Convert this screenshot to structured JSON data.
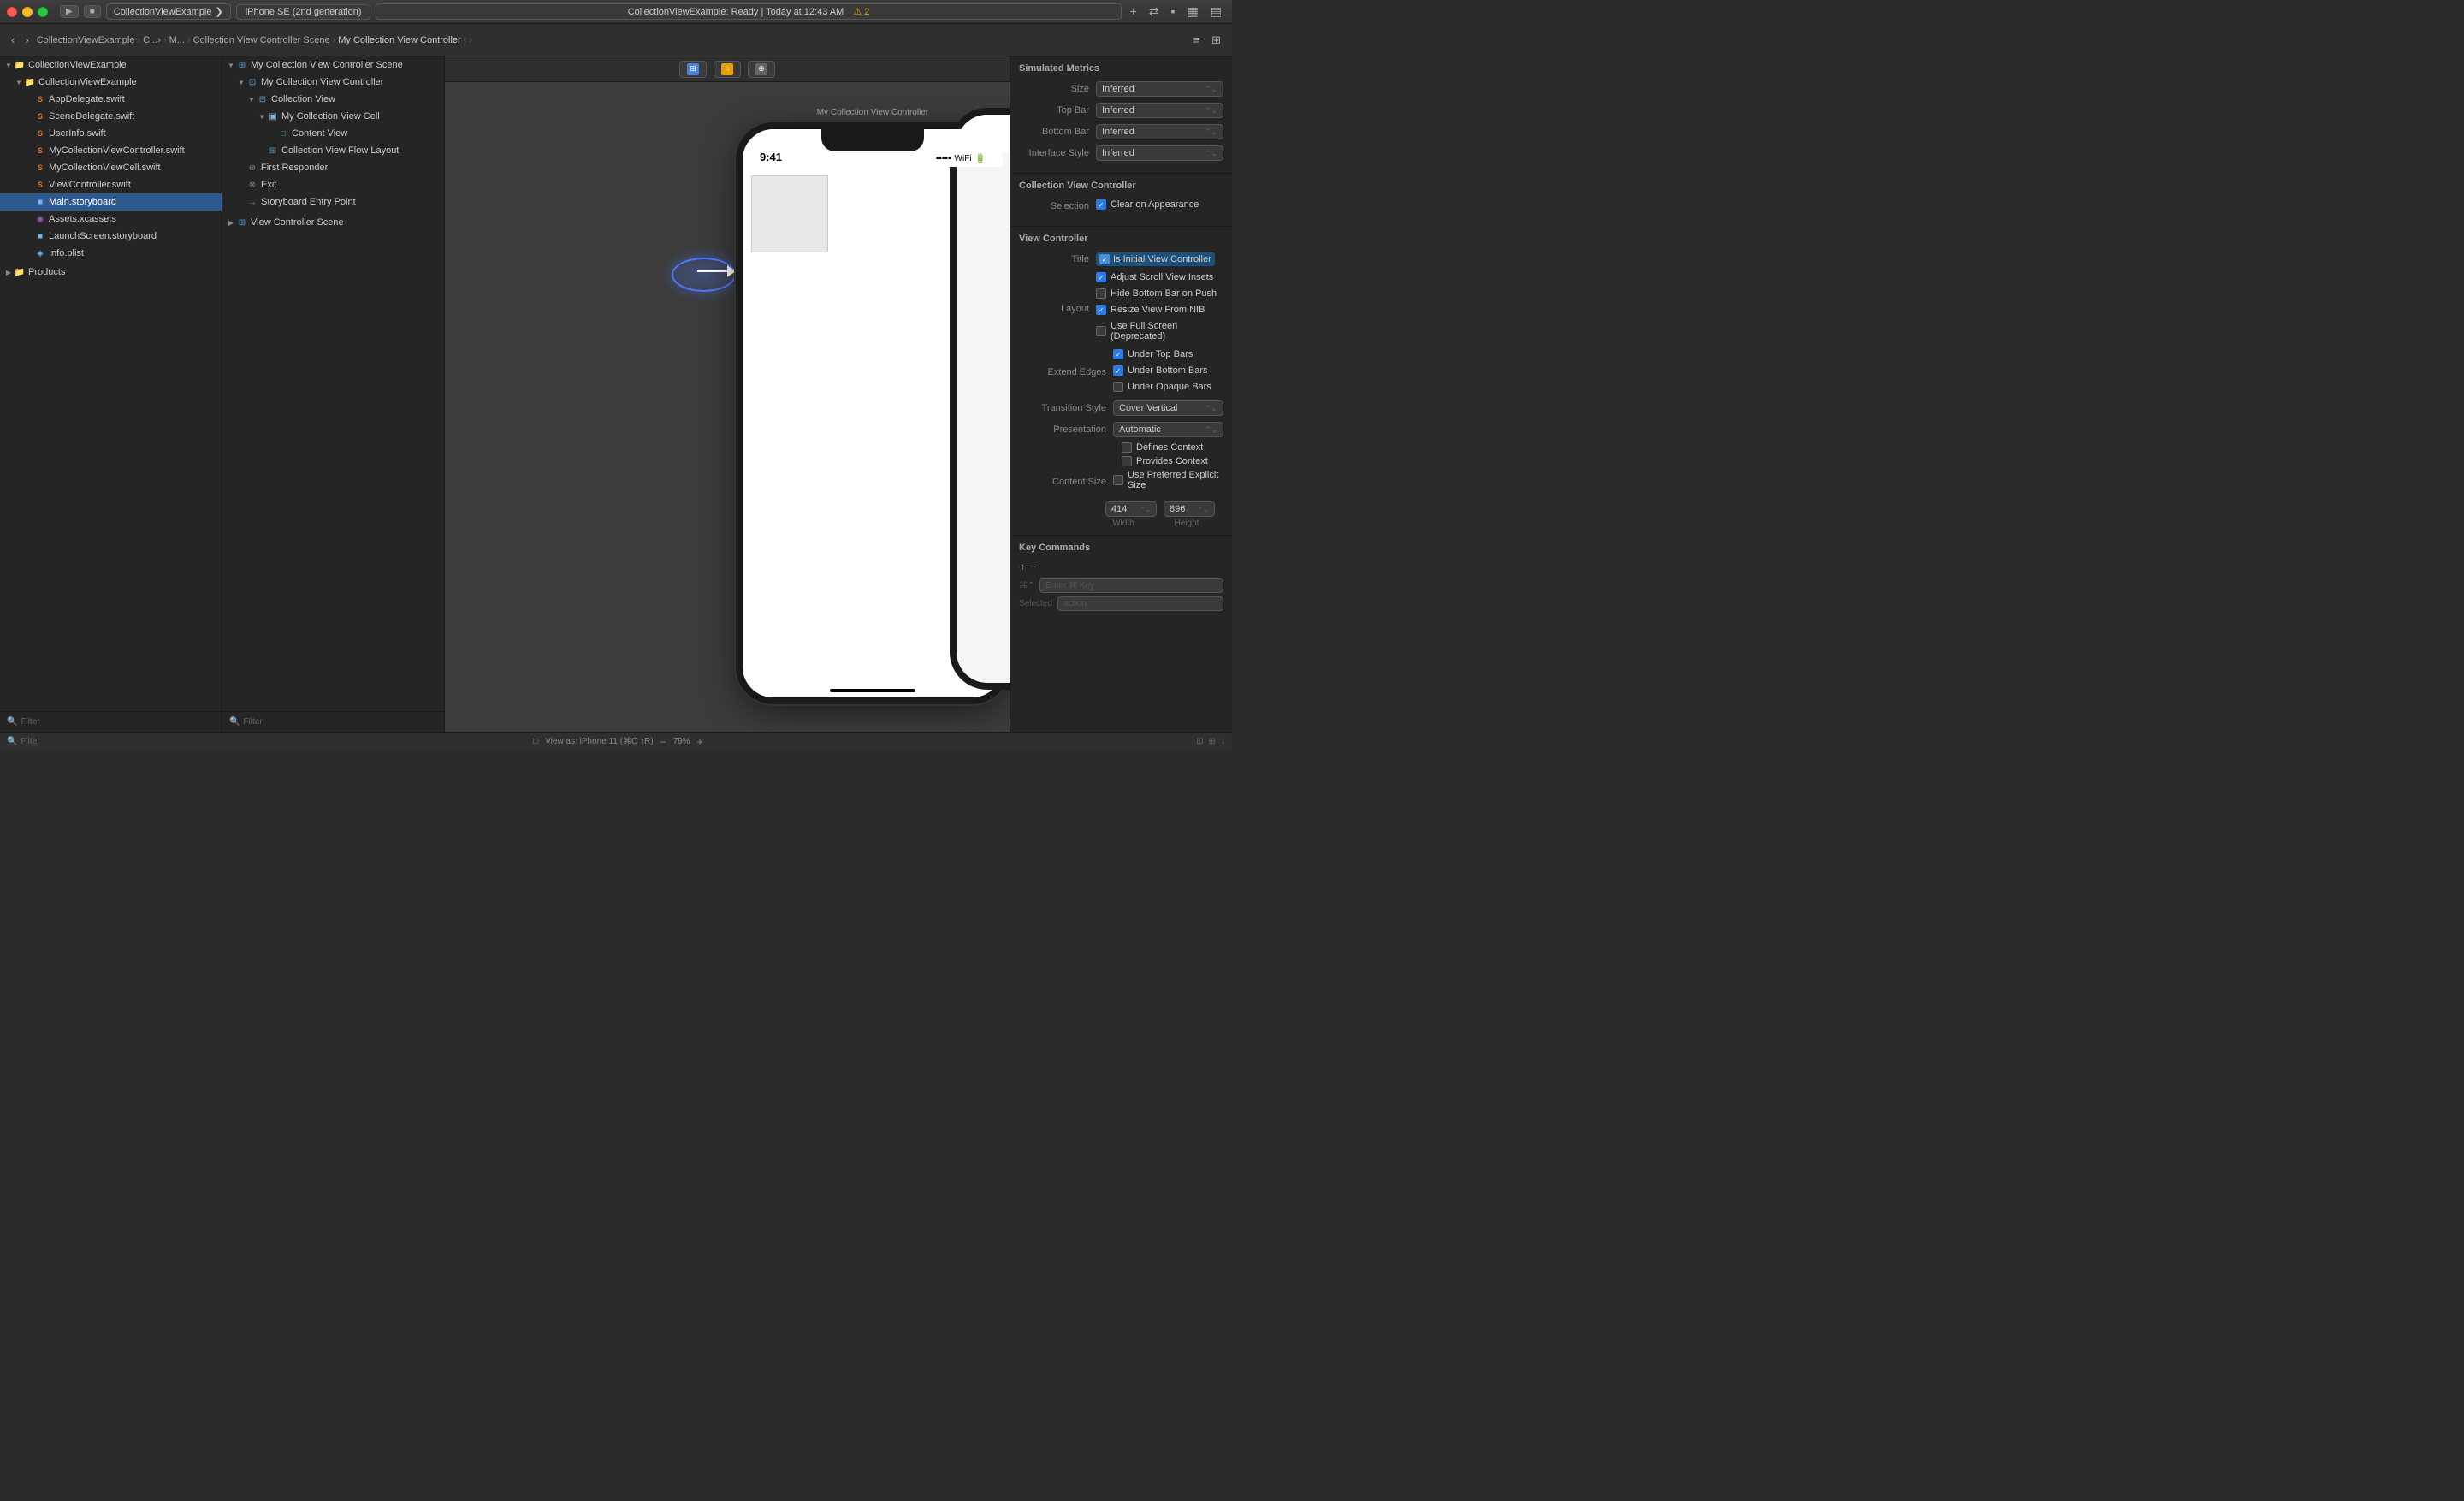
{
  "titlebar": {
    "traffic_lights": [
      "close",
      "minimize",
      "maximize"
    ],
    "scheme_label": "CollectionViewExample",
    "scheme_arrow": "▸",
    "device_label": "iPhone SE (2nd generation)",
    "status_label": "CollectionViewExample: Ready",
    "status_time": "Today at 12:43 AM",
    "warning_icon": "⚠",
    "warning_count": "2",
    "add_btn": "+",
    "arrows_btn": "⇄",
    "layout_btns": [
      "▪",
      "▦",
      "▤"
    ]
  },
  "toolbar": {
    "nav_back": "‹",
    "nav_forward": "›",
    "breadcrumbs": [
      "CollectionViewExample",
      "C...>",
      "M...",
      "Collection View Controller Scene",
      "My Collection View Controller"
    ],
    "nav_arrows": [
      "‹",
      "›"
    ],
    "right_icons": [
      "≡",
      "⊞"
    ]
  },
  "navigator": {
    "title": "CollectionViewExample",
    "root_folder": "CollectionViewExample",
    "items": [
      {
        "label": "CollectionViewExample",
        "type": "group_folder",
        "level": 0,
        "expanded": true
      },
      {
        "label": "AppDelegate.swift",
        "type": "swift",
        "level": 1
      },
      {
        "label": "SceneDelegate.swift",
        "type": "swift",
        "level": 1
      },
      {
        "label": "UserInfo.swift",
        "type": "swift",
        "level": 1
      },
      {
        "label": "MyCollectionViewController.swift",
        "type": "swift",
        "level": 1
      },
      {
        "label": "MyCollectionViewCell.swift",
        "type": "swift",
        "level": 1
      },
      {
        "label": "ViewController.swift",
        "type": "swift",
        "level": 1
      },
      {
        "label": "Main.storyboard",
        "type": "storyboard",
        "level": 1,
        "selected": true
      },
      {
        "label": "Assets.xcassets",
        "type": "xcassets",
        "level": 1
      },
      {
        "label": "LaunchScreen.storyboard",
        "type": "storyboard",
        "level": 1
      },
      {
        "label": "Info.plist",
        "type": "plist",
        "level": 1
      },
      {
        "label": "Products",
        "type": "products_folder",
        "level": 0,
        "expanded": false
      }
    ],
    "filter_placeholder": "Filter"
  },
  "storyboard": {
    "scene_label1": "My Collection View Controller Scene",
    "scene_label2": "View Controller Scene",
    "tree_items": [
      {
        "label": "My Collection View Controller Scene",
        "type": "scene",
        "level": 0,
        "expanded": true
      },
      {
        "label": "My Collection View Controller",
        "type": "vc",
        "level": 1,
        "expanded": true
      },
      {
        "label": "Collection View",
        "type": "view",
        "level": 2,
        "expanded": true
      },
      {
        "label": "My Collection View Cell",
        "type": "cell",
        "level": 3,
        "expanded": true
      },
      {
        "label": "Content View",
        "type": "content",
        "level": 4
      },
      {
        "label": "Collection View Flow Layout",
        "type": "layout",
        "level": 3
      },
      {
        "label": "First Responder",
        "type": "responder",
        "level": 1
      },
      {
        "label": "Exit",
        "type": "exit",
        "level": 1
      },
      {
        "label": "Storyboard Entry Point",
        "type": "entry",
        "level": 1
      },
      {
        "label": "View Controller Scene",
        "type": "scene",
        "level": 0,
        "expanded": false
      }
    ]
  },
  "canvas": {
    "iphone_time": "9:41",
    "iphone_time_partial": "9:4",
    "view_label": "View as: iPhone 11 (⌘C ↑R)",
    "zoom": "79%"
  },
  "inspector": {
    "title": "Collection View Controller",
    "simulated_metrics": {
      "label": "Simulated Metrics",
      "size_label": "Size",
      "size_value": "Inferred",
      "top_bar_label": "Top Bar",
      "top_bar_value": "Inferred",
      "bottom_bar_label": "Bottom Bar",
      "bottom_bar_value": "Inferred",
      "interface_style_label": "Interface Style",
      "interface_style_value": "Inferred"
    },
    "collection_view_controller": {
      "label": "Collection View Controller",
      "selection_label": "Selection",
      "clear_on_appearance": "Clear on Appearance",
      "clear_on_appearance_checked": true
    },
    "view_controller": {
      "label": "View Controller",
      "title_label": "Title",
      "is_initial_label": "Is Initial View Controller",
      "is_initial_checked": true,
      "layout_label": "Layout",
      "adjust_scroll": "Adjust Scroll View Insets",
      "adjust_scroll_checked": true,
      "hide_bottom": "Hide Bottom Bar on Push",
      "hide_bottom_checked": false,
      "resize_nib": "Resize View From NIB",
      "resize_nib_checked": true,
      "use_full": "Use Full Screen (Deprecated)",
      "use_full_checked": false,
      "extend_edges_label": "Extend Edges",
      "under_top": "Under Top Bars",
      "under_top_checked": true,
      "under_bottom": "Under Bottom Bars",
      "under_bottom_checked": true,
      "under_opaque": "Under Opaque Bars",
      "under_opaque_checked": false,
      "transition_label": "Transition Style",
      "transition_value": "Cover Vertical",
      "presentation_label": "Presentation",
      "presentation_value": "Automatic",
      "defines_context": "Defines Context",
      "defines_context_checked": false,
      "provides_context": "Provides Context",
      "provides_context_checked": false,
      "content_size_label": "Content Size",
      "use_preferred": "Use Preferred Explicit Size",
      "use_preferred_checked": false,
      "width_value": "414",
      "height_value": "896",
      "width_label": "Width",
      "height_label": "Height"
    },
    "key_commands": {
      "label": "Key Commands",
      "enter_key_placeholder": "Enter ⌘ Key",
      "action_placeholder": "action"
    }
  },
  "statusbar": {
    "filter_label": "Filter",
    "view_as_label": "View as: iPhone 11 (⌘C ↑R)",
    "zoom_minus": "−",
    "zoom_value": "79%",
    "zoom_plus": "+"
  }
}
